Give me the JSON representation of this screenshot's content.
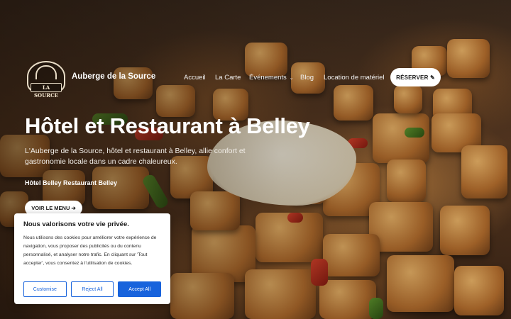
{
  "site": {
    "name": "Auberge de la Source",
    "logo_text": "LA SOURCE"
  },
  "nav": {
    "items": [
      {
        "label": "Accueil"
      },
      {
        "label": "La Carte"
      },
      {
        "label": "Événements",
        "has_dropdown": true
      },
      {
        "label": "Blog"
      },
      {
        "label": "Location de matériel"
      }
    ],
    "reserve_label": "RÉSERVER ✎"
  },
  "hero": {
    "title": "Hôtel et Restaurant à Belley",
    "description": "L'Auberge de la Source, hôtel et restaurant à Belley, allie confort et gastronomie locale dans un cadre chaleureux.",
    "subtitle": "Hôtel Belley Restaurant Belley",
    "menu_button": "VOIR LE MENU ➔"
  },
  "cookie_banner": {
    "title": "Nous valorisons votre vie privée.",
    "text": "Nous utilisons des cookies pour améliorer votre expérience de navigation, vous proposer des publicités ou du contenu personnalisé, et analyser notre trafic. En cliquant sur 'Tout accepter', vous consentez à l'utilisation de cookies.",
    "buttons": {
      "customise": "Customise",
      "reject": "Reject All",
      "accept": "Accept All"
    },
    "accent_color": "#1863dc"
  }
}
